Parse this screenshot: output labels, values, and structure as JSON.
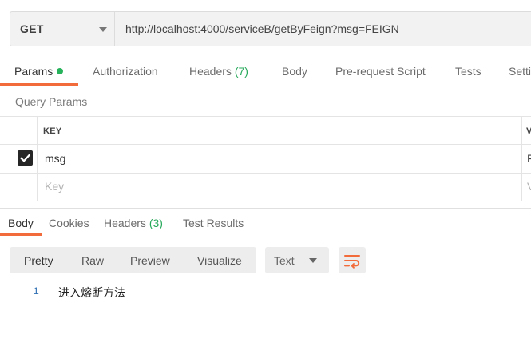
{
  "request": {
    "method": "GET",
    "url": "http://localhost:4000/serviceB/getByFeign?msg=FEIGN"
  },
  "request_tabs": [
    {
      "label": "Params",
      "active": true,
      "has_dot": true
    },
    {
      "label": "Authorization"
    },
    {
      "label": "Headers",
      "count": "(7)"
    },
    {
      "label": "Body"
    },
    {
      "label": "Pre-request Script"
    },
    {
      "label": "Tests"
    },
    {
      "label": "Setti"
    }
  ],
  "query_params": {
    "title": "Query Params",
    "key_header": "KEY",
    "value_header": "V",
    "rows": [
      {
        "checked": true,
        "key": "msg",
        "value_peek": "F"
      },
      {
        "key_placeholder": "Key",
        "value_placeholder_peek": "V"
      }
    ]
  },
  "response_tabs": [
    {
      "label": "Body",
      "active": true
    },
    {
      "label": "Cookies"
    },
    {
      "label": "Headers",
      "count": "(3)"
    },
    {
      "label": "Test Results"
    }
  ],
  "view_modes": [
    "Pretty",
    "Raw",
    "Preview",
    "Visualize"
  ],
  "format": "Text",
  "response_body": [
    {
      "line": "1",
      "text": "进入熔断方法"
    }
  ],
  "colors": {
    "accent": "#f26b3a",
    "count_green": "#26a85a",
    "status_dot": "#26b25a",
    "line_number": "#2f6fb3"
  }
}
